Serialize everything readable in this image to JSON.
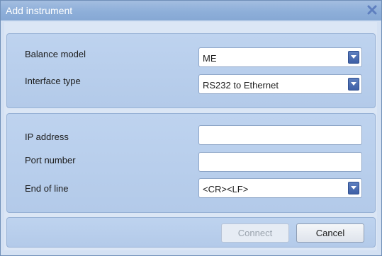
{
  "window": {
    "title": "Add instrument",
    "close_icon": "close-icon"
  },
  "instrument": {
    "balance_model_label": "Balance model",
    "balance_model_value": "ME",
    "interface_type_label": "Interface type",
    "interface_type_value": "RS232 to Ethernet"
  },
  "connection": {
    "ip_address_label": "IP address",
    "ip_address_value": "",
    "port_number_label": "Port number",
    "port_number_value": "",
    "end_of_line_label": "End of line",
    "end_of_line_value": "<CR><LF>"
  },
  "buttons": {
    "connect_label": "Connect",
    "connect_enabled": false,
    "cancel_label": "Cancel"
  },
  "colors": {
    "titlebar": "#8eafd9",
    "panel": "#b8cdec",
    "dropdown_arrow": "#4a6cb0",
    "close_icon": "#5e7fbf"
  }
}
